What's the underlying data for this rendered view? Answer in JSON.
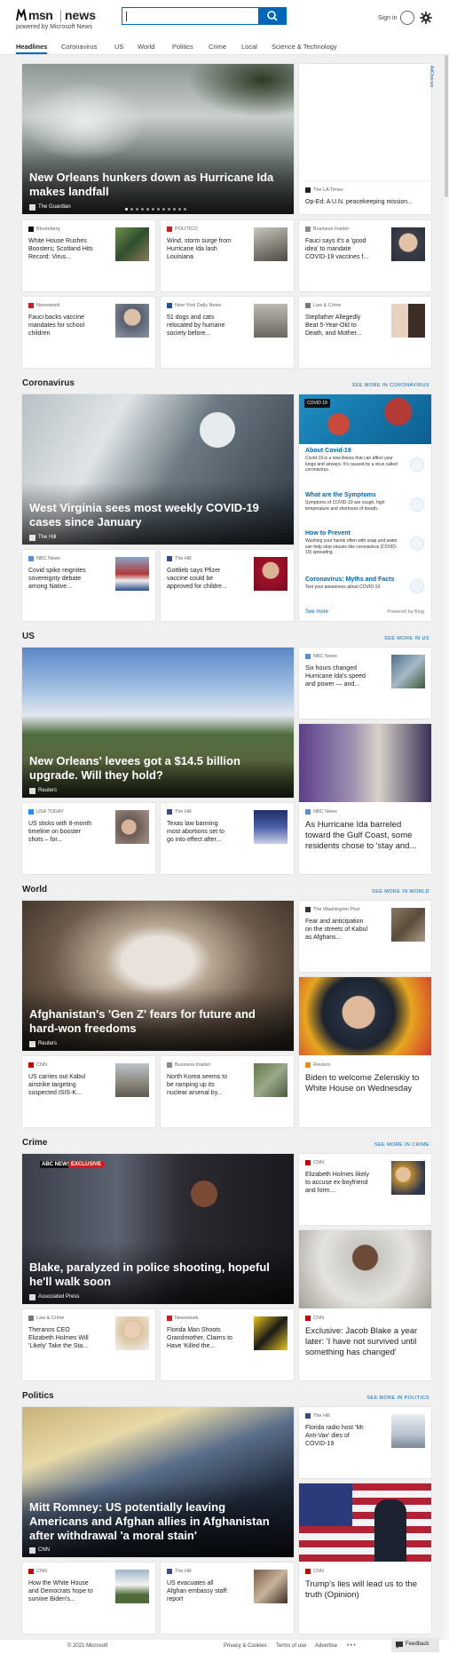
{
  "header": {
    "brand_msn": "msn",
    "brand_news": "news",
    "powered_by": "powered by Microsoft News",
    "sign_in": "Sign in",
    "search": {
      "value": "",
      "placeholder": ""
    }
  },
  "nav": [
    "Headlines",
    "Coronavirus",
    "US",
    "World",
    "Politics",
    "Crime",
    "Local",
    "Science & Technology"
  ],
  "adchoices": "AdChoices",
  "top": {
    "hero": {
      "title": "New Orleans hunkers down as Hurricane Ida makes landfall",
      "source": "The Guardian"
    },
    "side_ad": {
      "source": "The LA Times",
      "title": "Op-Ed: A U.N. peacekeeping mission..."
    },
    "cards": [
      {
        "source": "Bloomberg",
        "title": "White House Rushes Boosters; Scotland Hits Record: Virus...",
        "color": "#111111"
      },
      {
        "source": "POLITICO",
        "title": "Wind, storm surge from Hurricane Ida lash Louisiana",
        "color": "#d01b20"
      },
      {
        "source": "Business Insider",
        "title": "Fauci says it's a 'good idea' to mandate COVID-19 vaccines f...",
        "color": "#8a8a8a"
      },
      {
        "source": "Newsweek",
        "title": "Fauci backs vaccine mandates for school children",
        "color": "#d01b20"
      },
      {
        "source": "New York Daily News",
        "title": "51 dogs and cats relocated by humane society before...",
        "color": "#1d4fa0"
      },
      {
        "source": "Law & Crime",
        "title": "Stepfather Allegedly Beat 5-Year-Old to Death, and Mother...",
        "color": "#777777"
      }
    ]
  },
  "coronavirus": {
    "heading": "Coronavirus",
    "see_more": "SEE MORE IN CORONAVIRUS",
    "hero": {
      "title": "West Virginia sees most weekly COVID-19 cases since January",
      "source": "The Hill"
    },
    "panel": {
      "badge": "COVID 19",
      "items": [
        {
          "title": "About Covid-19",
          "text": "Covid-19 is a new illness that can affect your lungs and airways. It's caused by a virus called coronavirus."
        },
        {
          "title": "What are the Symptoms",
          "text": "Symptoms of COVID-19 are cough, high temperature and shortness of breath."
        },
        {
          "title": "How to Prevent",
          "text": "Washing your hands often with soap and water can help stop viruses like coronavirus (COVID-19) spreading."
        },
        {
          "title": "Coronavirus: Myths and Facts",
          "text": "Test your awareness about COVID-19"
        }
      ],
      "see_more": "See more",
      "powered": "Powered by Bing"
    },
    "cards": [
      {
        "source": "NBC News",
        "title": "Covid spike reignites sovereignty debate among Native...",
        "color": "#5a8fd0"
      },
      {
        "source": "The Hill",
        "title": "Gottlieb says Pfizer vaccine could be approved for childre...",
        "color": "#3b4a8a"
      }
    ]
  },
  "us": {
    "heading": "US",
    "see_more": "SEE MORE IN US",
    "hero": {
      "title": "New Orleans' levees got a $14.5 billion upgrade. Will they hold?",
      "source": "Reuters"
    },
    "side_small": {
      "source": "NBC News",
      "title": "Six hours changed Hurricane Ida's speed and power — and...",
      "color": "#5a8fd0"
    },
    "side_big": {
      "source": "NBC News",
      "title": "As Hurricane Ida barreled toward the Gulf Coast, some residents chose to 'stay and...",
      "color": "#5a8fd0"
    },
    "cards": [
      {
        "source": "USA TODAY",
        "title": "US sticks with 8-month timeline on booster shots – for...",
        "color": "#1e90ff"
      },
      {
        "source": "The Hill",
        "title": "Texas law banning most abortions set to go into effect after...",
        "color": "#3b4a8a"
      }
    ]
  },
  "world": {
    "heading": "World",
    "see_more": "SEE MORE IN WORLD",
    "hero": {
      "title": "Afghanistan's 'Gen Z' fears for future and hard-won freedoms",
      "source": "Reuters"
    },
    "side_small": {
      "source": "The Washington Post",
      "title": "Fear and anticipation on the streets of Kabul as Afghans...",
      "color": "#333333"
    },
    "side_big": {
      "source": "Reuters",
      "title": "Biden to welcome Zelenskiy to White House on Wednesday",
      "color": "#f08a24"
    },
    "cards": [
      {
        "source": "CNN",
        "title": "US carries out Kabul airstrike targeting suspected ISIS-K...",
        "color": "#cc0000"
      },
      {
        "source": "Business Insider",
        "title": "North Korea seems to be ramping up its nuclear arsenal by...",
        "color": "#8a8a8a"
      }
    ]
  },
  "crime": {
    "heading": "Crime",
    "see_more": "SEE MORE IN CRIME",
    "hero": {
      "title": "Blake, paralyzed in police shooting, hopeful he'll walk soon",
      "source": "Associated Press",
      "overlay": "EXCLUSIVE",
      "network": "ABC NEWS"
    },
    "side_small": {
      "source": "CNN",
      "title": "Elizabeth Holmes likely to accuse ex-boyfriend and form...",
      "color": "#cc0000"
    },
    "side_big": {
      "source": "CNN",
      "title": "Exclusive: Jacob Blake a year later: 'I have not survived until something has changed'",
      "color": "#cc0000"
    },
    "cards": [
      {
        "source": "Law & Crime",
        "title": "Theranos CEO Elizabeth Holmes Will 'Likely' Take the Sta...",
        "color": "#777777"
      },
      {
        "source": "Newsweek",
        "title": "Florida Man Shoots Grandmother, Claims to Have 'Killed the...",
        "color": "#d01b20"
      }
    ]
  },
  "politics": {
    "heading": "Politics",
    "see_more": "SEE MORE IN POLITICS",
    "hero": {
      "title": "Mitt Romney: US potentially leaving Americans and Afghan allies in Afghanistan after withdrawal 'a moral stain'",
      "source": "CNN"
    },
    "side_small": {
      "source": "The Hill",
      "title": "Florida radio host 'Mr. Anti-Vax' dies of COVID-19",
      "color": "#3b4a8a"
    },
    "side_big": {
      "source": "CNN",
      "title": "Trump's lies will lead us to the truth (Opinion)",
      "color": "#cc0000"
    },
    "cards": [
      {
        "source": "CNN",
        "title": "How the White House and Democrats hope to survive Biden's...",
        "color": "#cc0000"
      },
      {
        "source": "The Hill",
        "title": "US evacuates all Afghan embassy staff: report",
        "color": "#3b4a8a"
      }
    ]
  },
  "footer": {
    "copyright": "© 2021 Microsoft",
    "privacy": "Privacy & Cookies",
    "terms": "Terms of use",
    "advertise": "Advertise",
    "more": "• • •",
    "feedback": "Feedback"
  }
}
